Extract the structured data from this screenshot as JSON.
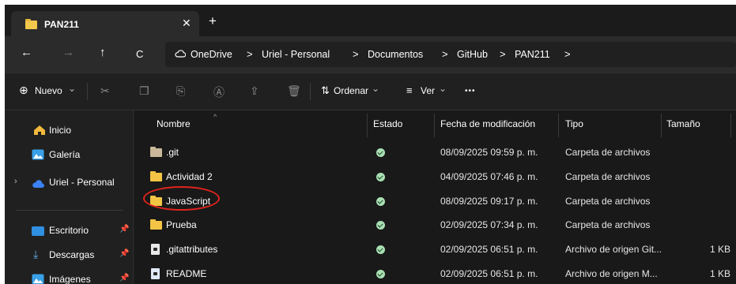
{
  "tab": {
    "title": "PAN211",
    "close": "✕",
    "new": "+"
  },
  "nav": {
    "back": "←",
    "forward": "→",
    "up": "↑",
    "refresh": "C"
  },
  "breadcrumb": {
    "onedrive": "OneDrive",
    "items": [
      "Uriel - Personal",
      "Documentos",
      "GitHub",
      "PAN211"
    ],
    "separator": ">"
  },
  "toolbar": {
    "new_label": "Nuevo",
    "sort_label": "Ordenar",
    "view_label": "Ver",
    "more": "•••",
    "chev": "⌄"
  },
  "sidebar": {
    "home": "Inicio",
    "gallery": "Galería",
    "personal": "Uriel - Personal",
    "desktop": "Escritorio",
    "downloads": "Descargas",
    "images": "Imágenes"
  },
  "columns": {
    "name": "Nombre",
    "status": "Estado",
    "modified": "Fecha de modificación",
    "type": "Tipo",
    "size": "Tamaño"
  },
  "files": [
    {
      "name": ".git",
      "modified": "08/09/2025 09:59 p. m.",
      "type": "Carpeta de archivos",
      "size": ""
    },
    {
      "name": "Actividad 2",
      "modified": "04/09/2025 07:46 p. m.",
      "type": "Carpeta de archivos",
      "size": ""
    },
    {
      "name": "JavaScript",
      "modified": "08/09/2025 09:17 p. m.",
      "type": "Carpeta de archivos",
      "size": ""
    },
    {
      "name": "Prueba",
      "modified": "02/09/2025 07:34 p. m.",
      "type": "Carpeta de archivos",
      "size": ""
    },
    {
      "name": ".gitattributes",
      "modified": "02/09/2025 06:51 p. m.",
      "type": "Archivo de origen Git...",
      "size": "1 KB"
    },
    {
      "name": "README",
      "modified": "02/09/2025 06:51 p. m.",
      "type": "Archivo de origen M...",
      "size": "1 KB"
    }
  ],
  "colors": {
    "folder": "#f4c544",
    "status_ok": "#a8e0b4",
    "highlight": "#e0241b"
  }
}
